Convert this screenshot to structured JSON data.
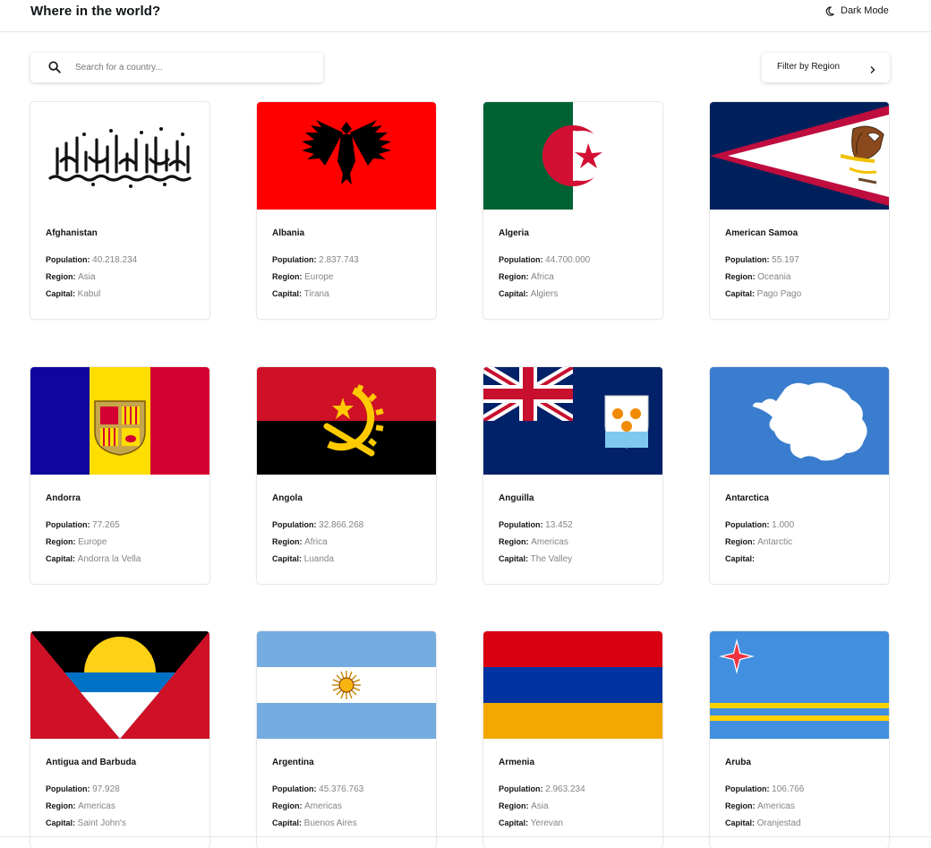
{
  "header": {
    "title": "Where in the world?",
    "mode_label": "Dark Mode",
    "mode_icon": "moon-icon"
  },
  "search": {
    "placeholder": "Search for a country...",
    "value": "",
    "icon": "search-icon"
  },
  "filter": {
    "label": "Filter by Region",
    "icon": "chevron-right-icon"
  },
  "labels": {
    "population": "Population:",
    "region": "Region:",
    "capital": "Capital:"
  },
  "countries": [
    {
      "name": "Afghanistan",
      "population": "40.218.234",
      "region": "Asia",
      "capital": "Kabul",
      "flag": "afghanistan-flag"
    },
    {
      "name": "Albania",
      "population": "2.837.743",
      "region": "Europe",
      "capital": "Tirana",
      "flag": "albania-flag"
    },
    {
      "name": "Algeria",
      "population": "44.700.000",
      "region": "Africa",
      "capital": "Algiers",
      "flag": "algeria-flag"
    },
    {
      "name": "American Samoa",
      "population": "55.197",
      "region": "Oceania",
      "capital": "Pago Pago",
      "flag": "american-samoa-flag"
    },
    {
      "name": "Andorra",
      "population": "77.265",
      "region": "Europe",
      "capital": "Andorra la Vella",
      "flag": "andorra-flag"
    },
    {
      "name": "Angola",
      "population": "32.866.268",
      "region": "Africa",
      "capital": "Luanda",
      "flag": "angola-flag"
    },
    {
      "name": "Anguilla",
      "population": "13.452",
      "region": "Americas",
      "capital": "The Valley",
      "flag": "anguilla-flag"
    },
    {
      "name": "Antarctica",
      "population": "1.000",
      "region": "Antarctic",
      "capital": "",
      "flag": "antarctica-flag"
    },
    {
      "name": "Antigua and Barbuda",
      "population": "97.928",
      "region": "Americas",
      "capital": "Saint John's",
      "flag": "antigua-and-barbuda-flag"
    },
    {
      "name": "Argentina",
      "population": "45.376.763",
      "region": "Americas",
      "capital": "Buenos Aires",
      "flag": "argentina-flag"
    },
    {
      "name": "Armenia",
      "population": "2.963.234",
      "region": "Asia",
      "capital": "Yerevan",
      "flag": "armenia-flag"
    },
    {
      "name": "Aruba",
      "population": "106.766",
      "region": "Americas",
      "capital": "Oranjestad",
      "flag": "aruba-flag"
    }
  ]
}
